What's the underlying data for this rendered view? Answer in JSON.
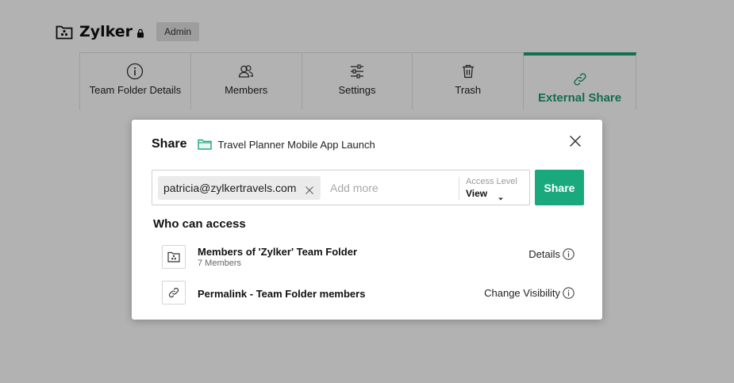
{
  "app": {
    "title": "Zylker",
    "badge": "Admin"
  },
  "tabs": [
    {
      "label": "Team Folder Details",
      "icon": "info-circle-icon"
    },
    {
      "label": "Members",
      "icon": "members-icon"
    },
    {
      "label": "Settings",
      "icon": "sliders-icon"
    },
    {
      "label": "Trash",
      "icon": "trash-icon"
    },
    {
      "label": "External Share",
      "icon": "link-icon",
      "active": true
    }
  ],
  "modal": {
    "title": "Share",
    "folder_name": "Travel Planner Mobile App Launch",
    "recipient_chip": "patricia@zylkertravels.com",
    "add_more_placeholder": "Add more",
    "access_level_label": "Access Level",
    "access_level_value": "View",
    "share_button": "Share",
    "who_can_access": "Who can access",
    "rows": [
      {
        "title": "Members of 'Zylker' Team Folder",
        "subtitle": "7 Members",
        "action": "Details",
        "icon": "team-folder-icon"
      },
      {
        "title": "Permalink - Team Folder members",
        "action": "Change Visibility",
        "icon": "link-icon"
      }
    ]
  },
  "colors": {
    "accent": "#1aa97d",
    "active_tab": "#1d9b74",
    "folder_icon": "#23a97e"
  }
}
